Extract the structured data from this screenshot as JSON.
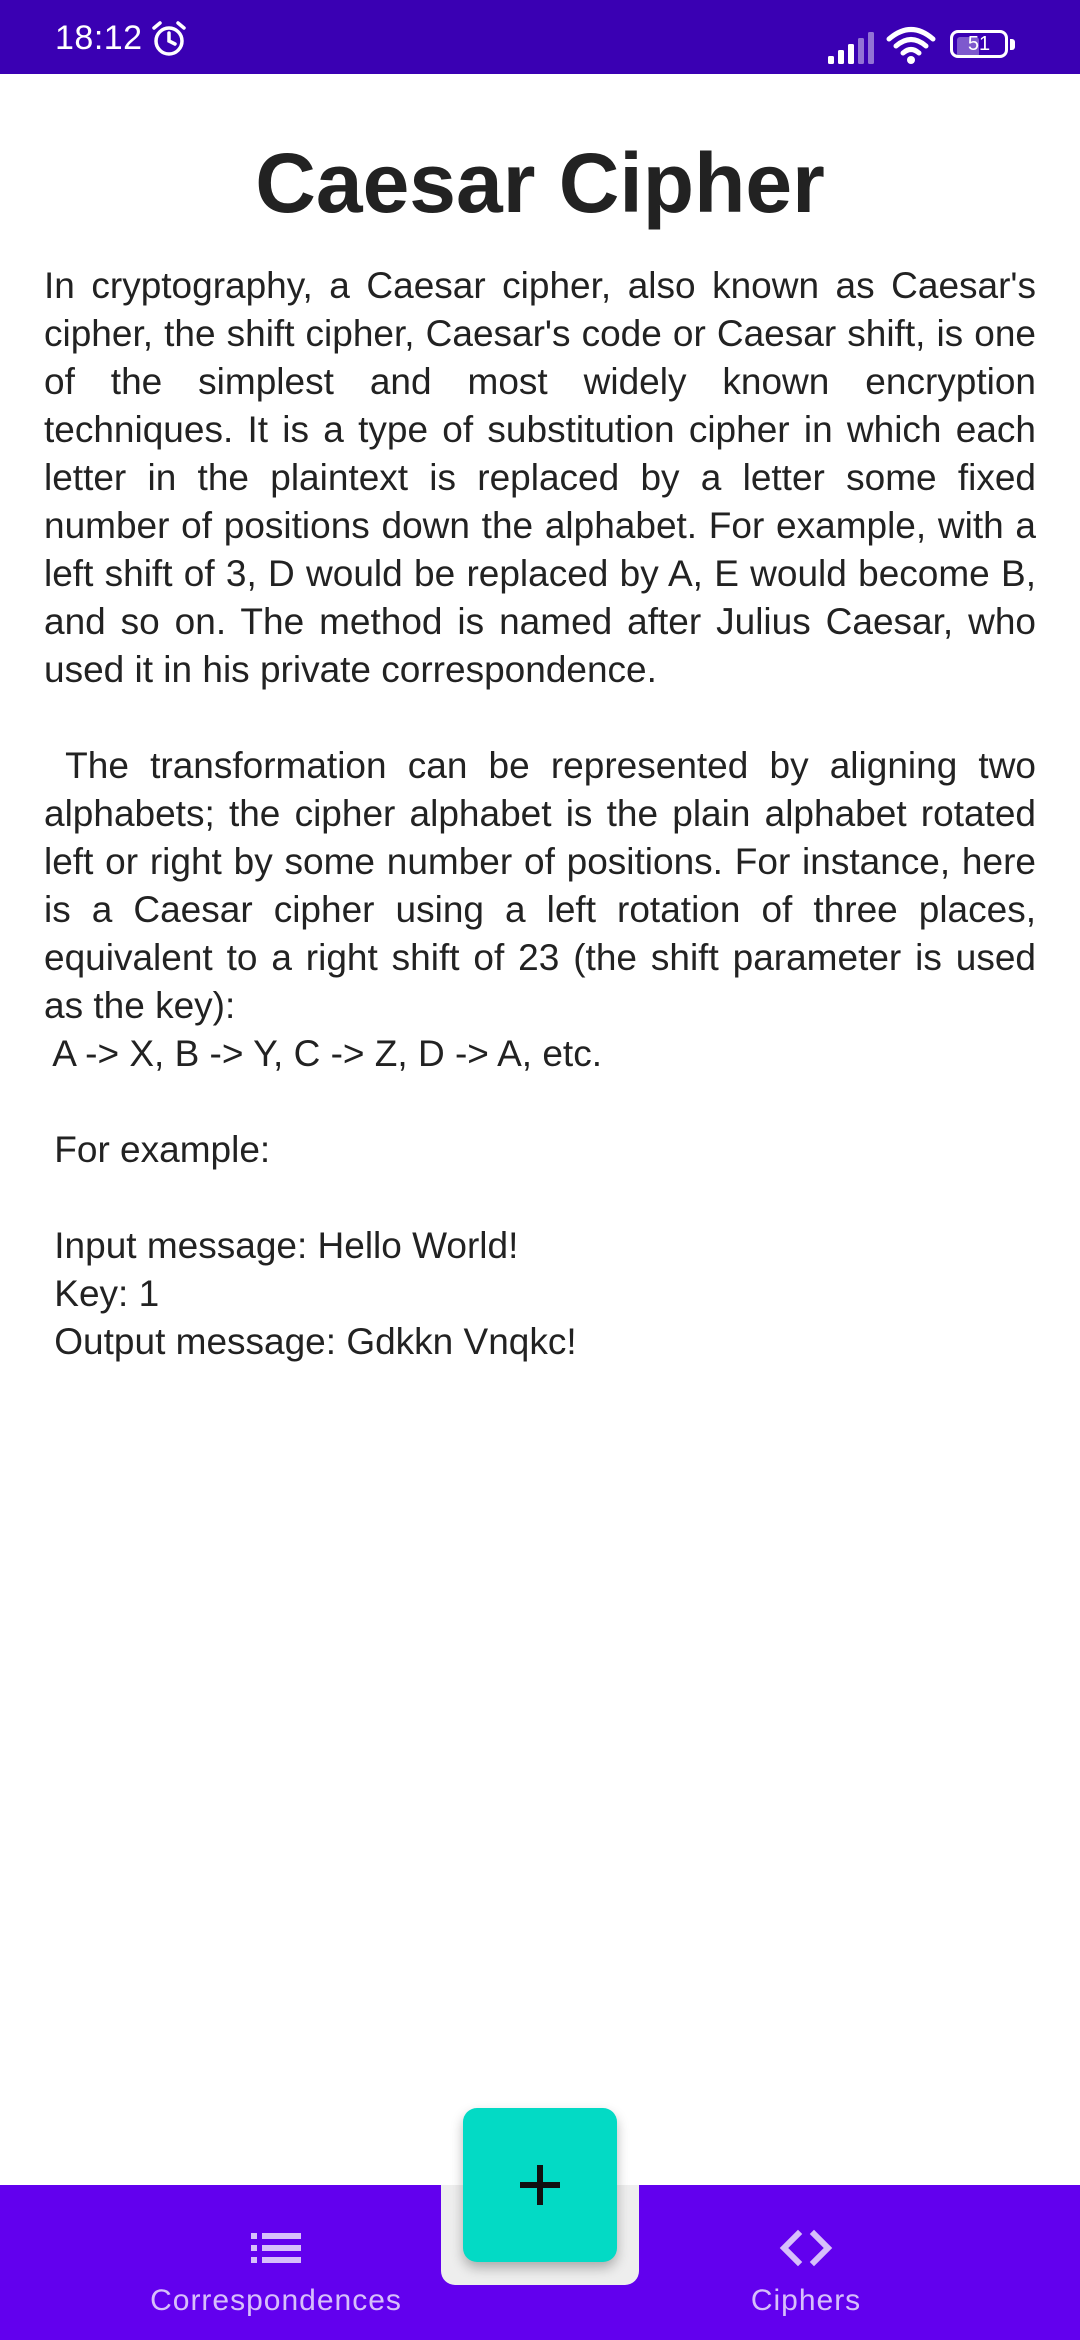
{
  "status_bar": {
    "time": "18:12",
    "battery": "51",
    "battery_level": 0.51
  },
  "page": {
    "title": "Caesar Cipher",
    "paragraph1": "In cryptography, a Caesar cipher, also known as Caesar's cipher, the shift cipher, Caesar's code or Caesar shift, is one of the simplest and most widely known encryption techniques. It is a type of substitution cipher in which each letter in the plaintext is replaced by a letter some fixed number of positions down the alphabet. For example, with a left shift of 3, D would be replaced by A, E would become B, and so on. The method is named after Julius Caesar, who used it in his private correspondence.",
    "paragraph2": " The transformation can be represented by aligning two alphabets; the cipher alphabet is the plain alphabet rotated left or right by some number of positions. For instance, here is a Caesar cipher using a left rotation of three places, equivalent to a right shift of 23 (the shift parameter is used as the key):",
    "mapping_line": " A -> X, B -> Y, C -> Z, D -> A, etc.",
    "example_heading": " For example:",
    "example_input": " Input message: Hello World!",
    "example_key": " Key: 1",
    "example_output": " Output message: Gdkkn Vnqkc!"
  },
  "bottom_nav": {
    "items": [
      {
        "label": "Correspondences",
        "icon": "list-icon"
      },
      {
        "label": "Ciphers",
        "icon": "code-icon"
      }
    ],
    "fab_icon": "plus-icon"
  },
  "colors": {
    "status_bar": "#3a00b3",
    "bottom_nav": "#6200ee",
    "fab": "#03dac5"
  }
}
